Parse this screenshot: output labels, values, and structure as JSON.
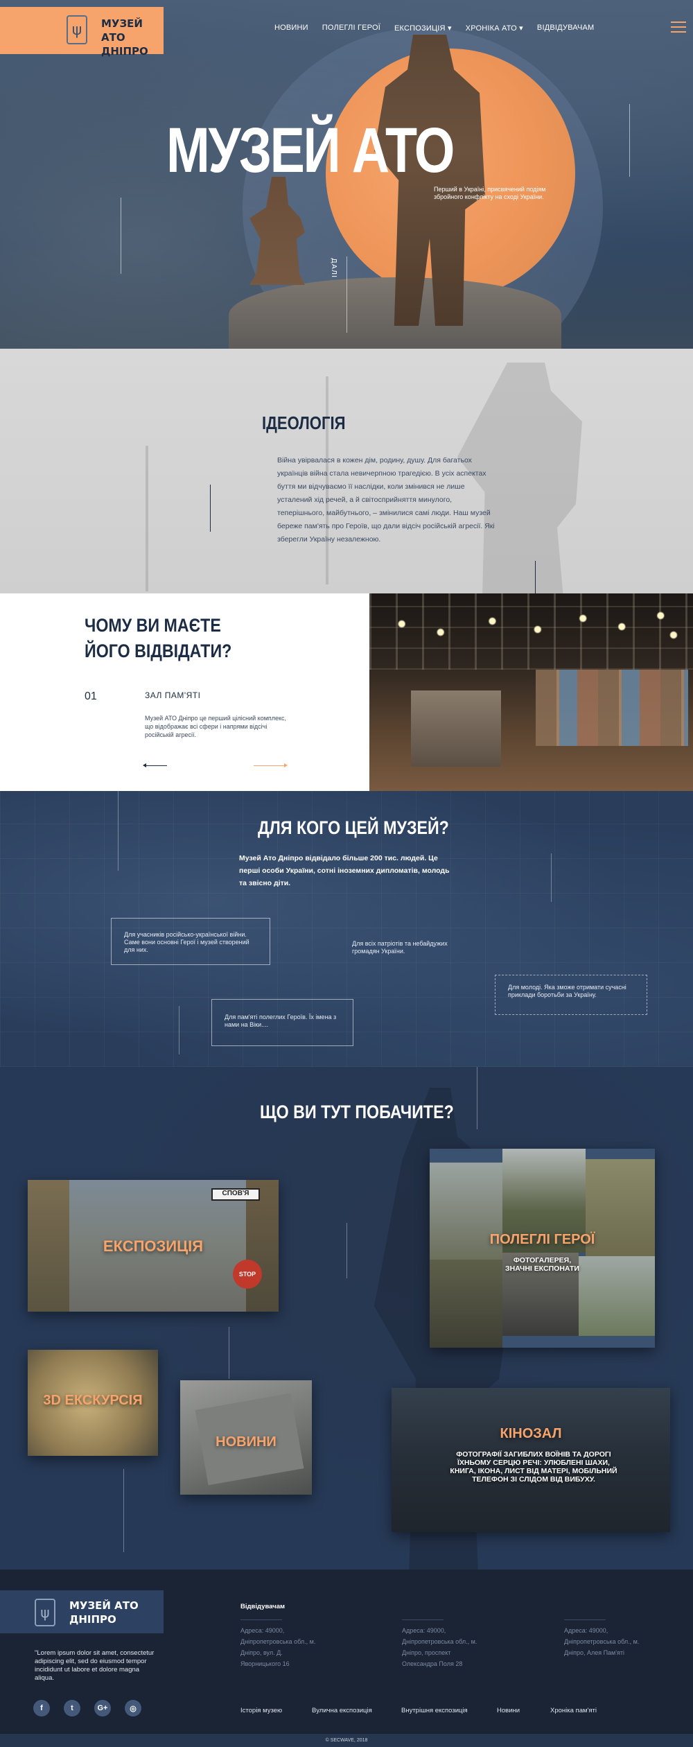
{
  "brand": {
    "name_line1": "МУЗЕЙ АТО",
    "name_line2": "ДНІПРО",
    "accent": "#f6a46b",
    "navy": "#1c2c44"
  },
  "nav": {
    "items": [
      {
        "label": "НОВИНИ"
      },
      {
        "label": "ПОЛЕГЛІ ГЕРОЇ"
      },
      {
        "label": "ЕКСПОЗИЦІЯ ▾"
      },
      {
        "label": "ХРОНІКА АТО ▾"
      },
      {
        "label": "ВІДВІДУВАЧАМ"
      }
    ],
    "menu_icon": "hamburger-icon"
  },
  "hero": {
    "title": "МУЗЕЙ АТО",
    "subtitle": "Перший в Україні, присвячений подіям збройного конфлікту на сході України.",
    "scroll_label": "ДАЛІ"
  },
  "ideology": {
    "title": "ІДЕОЛОГІЯ",
    "text": "Війна увірвалася в кожен дім, родину, душу. Для багатьох українців війна стала невичерпною трагедією. В усіх аспектах буття ми відчуваємо її наслідки, коли змінився не лише усталений хід речей, а й світосприйняття минулого, теперішнього, майбутнього, – змінилися самі люди. Наш музей береже пам'ять про Героїв, що дали відсіч російській агресії. Які зберегли Україну незалежною."
  },
  "why": {
    "title_line1": "ЧОМУ ВИ МАЄТЕ",
    "title_line2": "ЙОГО ВІДВІДАТИ?",
    "number": "01",
    "hall": "ЗАЛ ПАМ'ЯТІ",
    "description": "Музей АТО Дніпро  це перший цілісний комплекс, що відображає всі сфери і напрями відсічі російській агресії."
  },
  "whom": {
    "title": "ДЛЯ КОГО ЦЕЙ МУЗЕЙ?",
    "text": "Музей Ато Дніпро відвідало більше 200 тис. людей. Це перші особи України, сотні іноземних дипломатів, молодь та звісно діти.",
    "cards": [
      {
        "text": "Для учасників російсько-української війни. Саме вони основні Герої і музей створений для них."
      },
      {
        "text": "Для всіх патріотів та небайдужих громадян України."
      },
      {
        "text": "Для молоді. Яка зможе отримати сучасні приклади боротьби за Україну."
      },
      {
        "text": "Для пам'яті полеглих Героїв. Їх імена з нами на Віки...."
      }
    ]
  },
  "see": {
    "title": "ЩО ВИ ТУТ ПОБАЧИТЕ?",
    "tiles": {
      "exposition": "ЕКСПОЗИЦІЯ",
      "exposition_sign": "СПОВ'Я",
      "stop_sign": "STOP",
      "heroes": "ПОЛЕГЛІ ГЕРОЇ",
      "heroes_sub_line1": "ФОТОГАЛЕРЕЯ,",
      "heroes_sub_line2": "ЗНАЧНІ ЕКСПОНАТИ",
      "tour3d": "3D ЕКСКУРСІЯ",
      "news": "НОВИНИ",
      "cinema": "КІНОЗАЛ",
      "cinema_sub": "ФОТОГРАФІЇ ЗАГИБЛИХ ВОЇНІВ ТА ДОРОГІ ЇХНЬОМУ СЕРЦЮ РЕЧІ: УЛЮБЛЕНІ ШАХИ, КНИГА, ІКОНА, ЛИСТ ВІД МАТЕРІ, МОБІЛЬНИЙ ТЕЛЕФОН ЗІ СЛІДОМ ВІД ВИБУХУ."
    }
  },
  "footer": {
    "quote": "\"Lorem ipsum dolor sit amet, consectetur adipiscing elit, sed do eiusmod tempor incididunt ut labore et dolore magna aliqua.",
    "visitors_title": "Відвідувачам",
    "addresses": [
      {
        "line1": "Адреса: 49000,",
        "line2": "Дніпропетровська обл., м.",
        "line3": "Дніпро, вул. Д.",
        "line4": "Яворницького 16"
      },
      {
        "line1": "Адреса: 49000,",
        "line2": "Дніпропетровська обл., м.",
        "line3": "Дніпро, проспект",
        "line4": "Олександра Поля 28"
      },
      {
        "line1": "Адреса: 49000,",
        "line2": "Дніпропетровська обл., м.",
        "line3": "Дніпро, Алея Пам'яті",
        "line4": ""
      }
    ],
    "social": [
      {
        "icon": "facebook-icon",
        "glyph": "f"
      },
      {
        "icon": "twitter-icon",
        "glyph": "t"
      },
      {
        "icon": "google-plus-icon",
        "glyph": "G+"
      },
      {
        "icon": "instagram-icon",
        "glyph": "◎"
      }
    ],
    "links": [
      {
        "label": "Історія музею"
      },
      {
        "label": "Вулична експозиція"
      },
      {
        "label": "Внутрішня експозиція"
      },
      {
        "label": "Новини"
      },
      {
        "label": "Хроніка пам'яті"
      }
    ],
    "copyright": "© SECWAVE, 2018"
  }
}
